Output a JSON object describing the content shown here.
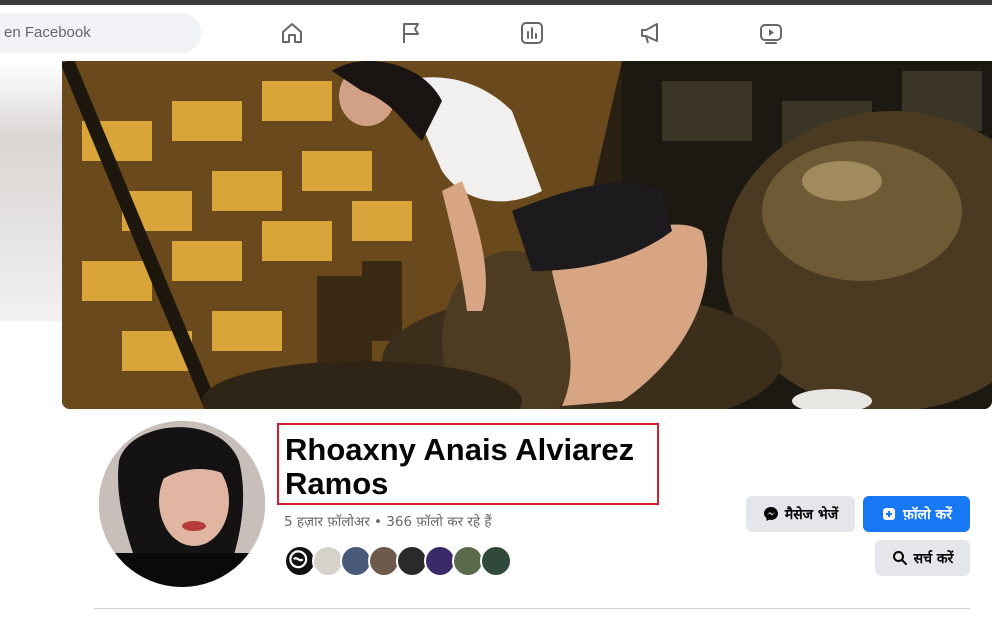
{
  "navbar": {
    "search_placeholder": "en Facebook",
    "icons": [
      "home-icon",
      "flag-icon",
      "stats-icon",
      "megaphone-icon",
      "video-icon"
    ]
  },
  "profile": {
    "name": "Rhoaxny Anais Alviarez Ramos",
    "stats": "5 हज़ार फ़ॉलोअर • 366 फ़ॉलो कर रहे हैं",
    "friend_count": 8
  },
  "actions": {
    "message_label": "मैसेज भेजें",
    "follow_label": "फ़ॉलो करें",
    "search_label": "सर्च करें"
  },
  "colors": {
    "brand_blue": "#1877f2",
    "highlight_red": "#d0202b",
    "secondary_button": "#e4e6eb"
  }
}
